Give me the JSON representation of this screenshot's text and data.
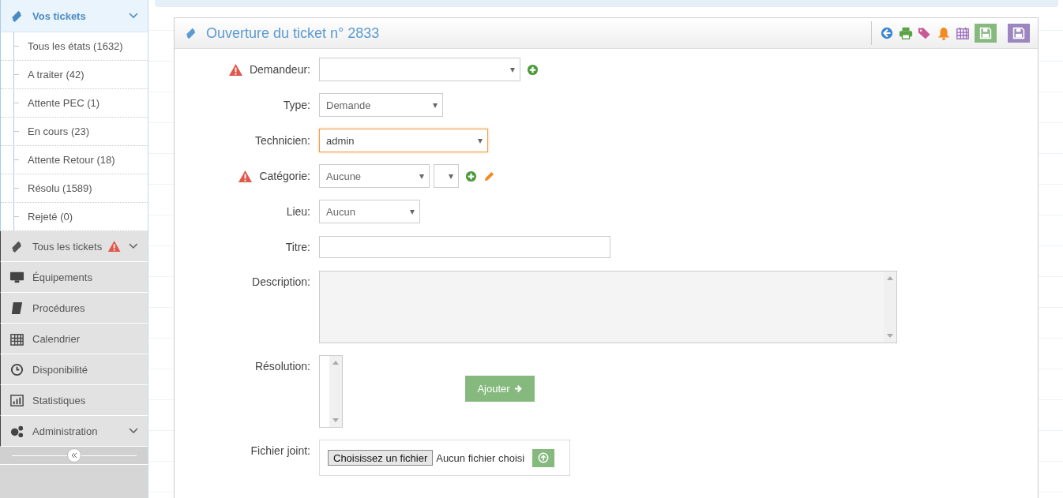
{
  "sidebar": {
    "items": [
      {
        "label": "Vos tickets",
        "kind": "group",
        "selected": true,
        "warning": false,
        "children": [
          {
            "label": "Tous les états (1632)"
          },
          {
            "label": "A traiter (42)"
          },
          {
            "label": "Attente PEC (1)"
          },
          {
            "label": "En cours (23)"
          },
          {
            "label": "Attente Retour (18)"
          },
          {
            "label": "Résolu (1589)"
          },
          {
            "label": "Rejeté (0)"
          }
        ]
      },
      {
        "label": "Tous les tickets",
        "kind": "group",
        "selected": false,
        "warning": true
      },
      {
        "label": "Équipements",
        "kind": "link",
        "selected": false,
        "warning": false
      },
      {
        "label": "Procédures",
        "kind": "link",
        "selected": false,
        "warning": false
      },
      {
        "label": "Calendrier",
        "kind": "link",
        "selected": false,
        "warning": false
      },
      {
        "label": "Disponibilité",
        "kind": "link",
        "selected": false,
        "warning": false
      },
      {
        "label": "Statistiques",
        "kind": "link",
        "selected": false,
        "warning": false
      },
      {
        "label": "Administration",
        "kind": "group",
        "selected": false,
        "warning": false
      }
    ]
  },
  "panel": {
    "title": "Ouverture du ticket n° 2833"
  },
  "form": {
    "fields": [
      {
        "label": "Demandeur:",
        "kind": "select",
        "required": true,
        "focused": false,
        "extra_select": false,
        "actions": [
          {
            "kind": "add"
          }
        ]
      },
      {
        "label": "Type:",
        "kind": "select",
        "value": "Demande",
        "required": false,
        "focused": false,
        "extra_select": false
      },
      {
        "label": "Technicien:",
        "kind": "select",
        "value": "admin",
        "required": false,
        "focused": true,
        "extra_select": false
      },
      {
        "label": "Catégorie:",
        "kind": "select",
        "value": "Aucune",
        "required": true,
        "focused": false,
        "extra_select": true,
        "actions": [
          {
            "kind": "add"
          },
          {
            "kind": "edit"
          }
        ]
      },
      {
        "label": "Lieu:",
        "kind": "select",
        "value": "Aucun",
        "required": false,
        "focused": false,
        "extra_select": false
      },
      {
        "label": "Titre:",
        "kind": "text",
        "required": false,
        "focused": false
      },
      {
        "label": "Description:",
        "kind": "textarea",
        "required": false,
        "focused": false
      },
      {
        "label": "Résolution:",
        "kind": "resolution",
        "required": false,
        "focused": false,
        "button": "Ajouter"
      },
      {
        "label": "Fichier joint:",
        "kind": "file",
        "required": false,
        "focused": false,
        "button": "Choisissez un fichier",
        "status": "Aucun fichier choisi"
      }
    ]
  }
}
